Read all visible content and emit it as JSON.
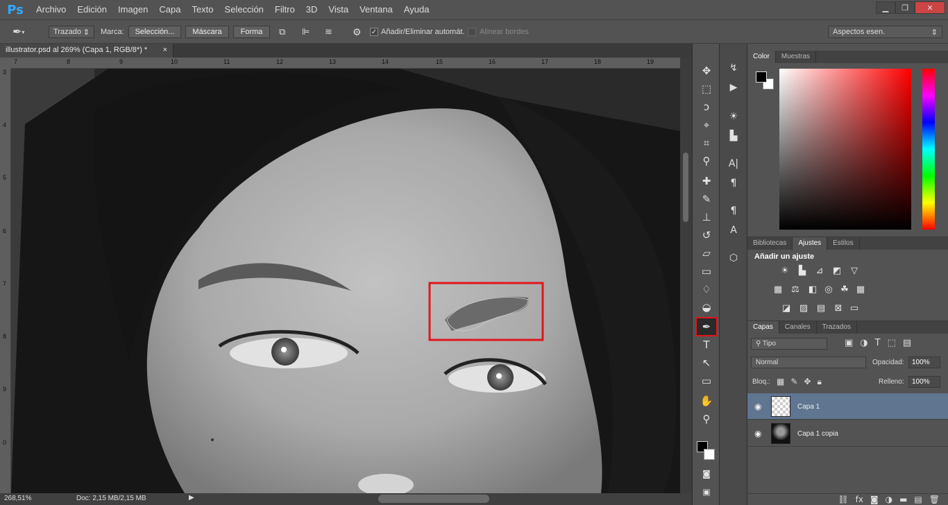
{
  "app": {
    "logo": "Ps"
  },
  "menu": [
    "Archivo",
    "Edición",
    "Imagen",
    "Capa",
    "Texto",
    "Selección",
    "Filtro",
    "3D",
    "Vista",
    "Ventana",
    "Ayuda"
  ],
  "window_controls": {
    "minimize": "▁",
    "restore": "❐",
    "close": "✕"
  },
  "options": {
    "mode_select": "Trazado",
    "marca_label": "Marca:",
    "seleccion_btn": "Selección...",
    "mascara_btn": "Máscara",
    "forma_btn": "Forma",
    "auto_add": "Añadir/Eliminar automát.",
    "auto_add_checked": true,
    "align_edges": "Alinear bordes",
    "align_edges_checked": false,
    "workspace": "Aspectos esen."
  },
  "document": {
    "tab_title": "illustrator.psd al 269% (Capa 1, RGB/8*) *",
    "close": "×"
  },
  "ruler_h": [
    "7",
    "8",
    "9",
    "10",
    "11",
    "12",
    "13",
    "14",
    "15",
    "16",
    "17",
    "18",
    "19"
  ],
  "ruler_v": [
    "3",
    "4",
    "5",
    "6",
    "7",
    "8",
    "9",
    "0"
  ],
  "status": {
    "zoom": "268,51%",
    "doc": "Doc: 2,15 MB/2,15 MB"
  },
  "color_panel": {
    "tabs": [
      "Color",
      "Muestras"
    ],
    "fg": "#000000",
    "bg": "#ffffff",
    "hue": "#ff0000"
  },
  "adjust_panel": {
    "tabs": [
      "Bibliotecas",
      "Ajustes",
      "Estilos"
    ],
    "title": "Añadir un ajuste"
  },
  "layers_panel": {
    "tabs": [
      "Capas",
      "Canales",
      "Trazados"
    ],
    "filter": "Tipo",
    "blend": "Normal",
    "opacity_label": "Opacidad:",
    "opacity": "100%",
    "lock_label": "Bloq.:",
    "fill_label": "Relleno:",
    "fill": "100%",
    "layers": [
      {
        "name": "Capa 1",
        "selected": true
      },
      {
        "name": "Capa 1 copia",
        "selected": false
      }
    ]
  },
  "layer_bottom_icons": [
    "link-icon",
    "fx-icon",
    "mask-icon",
    "adjustment-icon",
    "folder-icon",
    "new-layer-icon",
    "trash-icon"
  ]
}
